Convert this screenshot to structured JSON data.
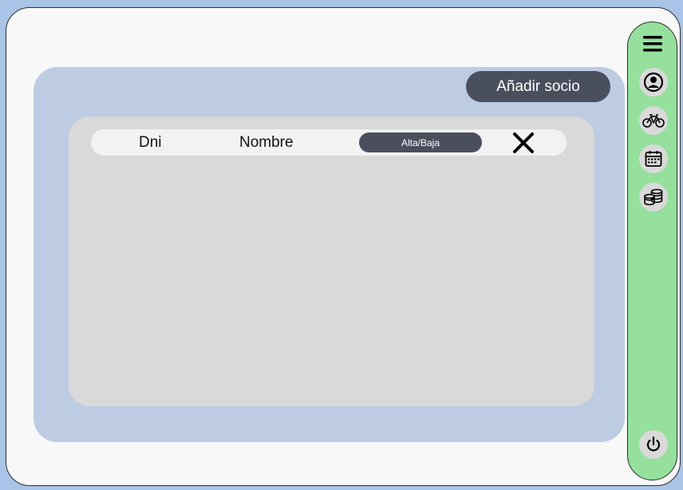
{
  "main": {
    "add_button_label": "Añadir socio",
    "table": {
      "columns": {
        "dni": "Dni",
        "nombre": "Nombre",
        "status": "Alta/Baja"
      }
    }
  },
  "sidebar": {
    "items": [
      {
        "icon": "user-circle-icon"
      },
      {
        "icon": "bicycle-icon"
      },
      {
        "icon": "calendar-icon"
      },
      {
        "icon": "coins-icon"
      }
    ],
    "bottom": {
      "icon": "power-icon"
    }
  },
  "colors": {
    "background": "#a9c4e6",
    "frame": "#f8f8f9",
    "main_panel": "#bdcbe3",
    "table_card": "#d9d9d9",
    "dark_button": "#4a4f5d",
    "sidebar": "#94e09c"
  }
}
